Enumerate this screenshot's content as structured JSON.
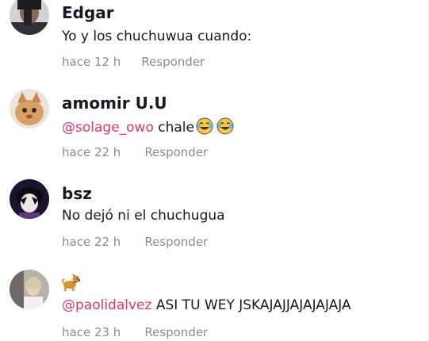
{
  "comments": [
    {
      "username": "Edgar",
      "text": "Yo y los chuchuwua cuando:",
      "time": "hace 12 h",
      "reply_label": "Responder"
    },
    {
      "username": "amomir U.U",
      "mention": "@solage_owo",
      "text": "chale",
      "emojis": [
        "laughing-tears-emoji",
        "laughing-tears-emoji"
      ],
      "time": "hace 22 h",
      "reply_label": "Responder"
    },
    {
      "username": "bsz",
      "text": "No dejó ni el chuchugua",
      "time": "hace 22 h",
      "reply_label": "Responder"
    },
    {
      "username_icon": "dog-emoji",
      "mention": "@paolidalvez",
      "text": "ASI TU WEY JSKAJAJJAJAJAJAJA",
      "time": "hace 23 h",
      "reply_label": "Responder"
    }
  ],
  "colors": {
    "mention": "#e0385f",
    "meta": "#8a8b91",
    "text": "#161823"
  }
}
